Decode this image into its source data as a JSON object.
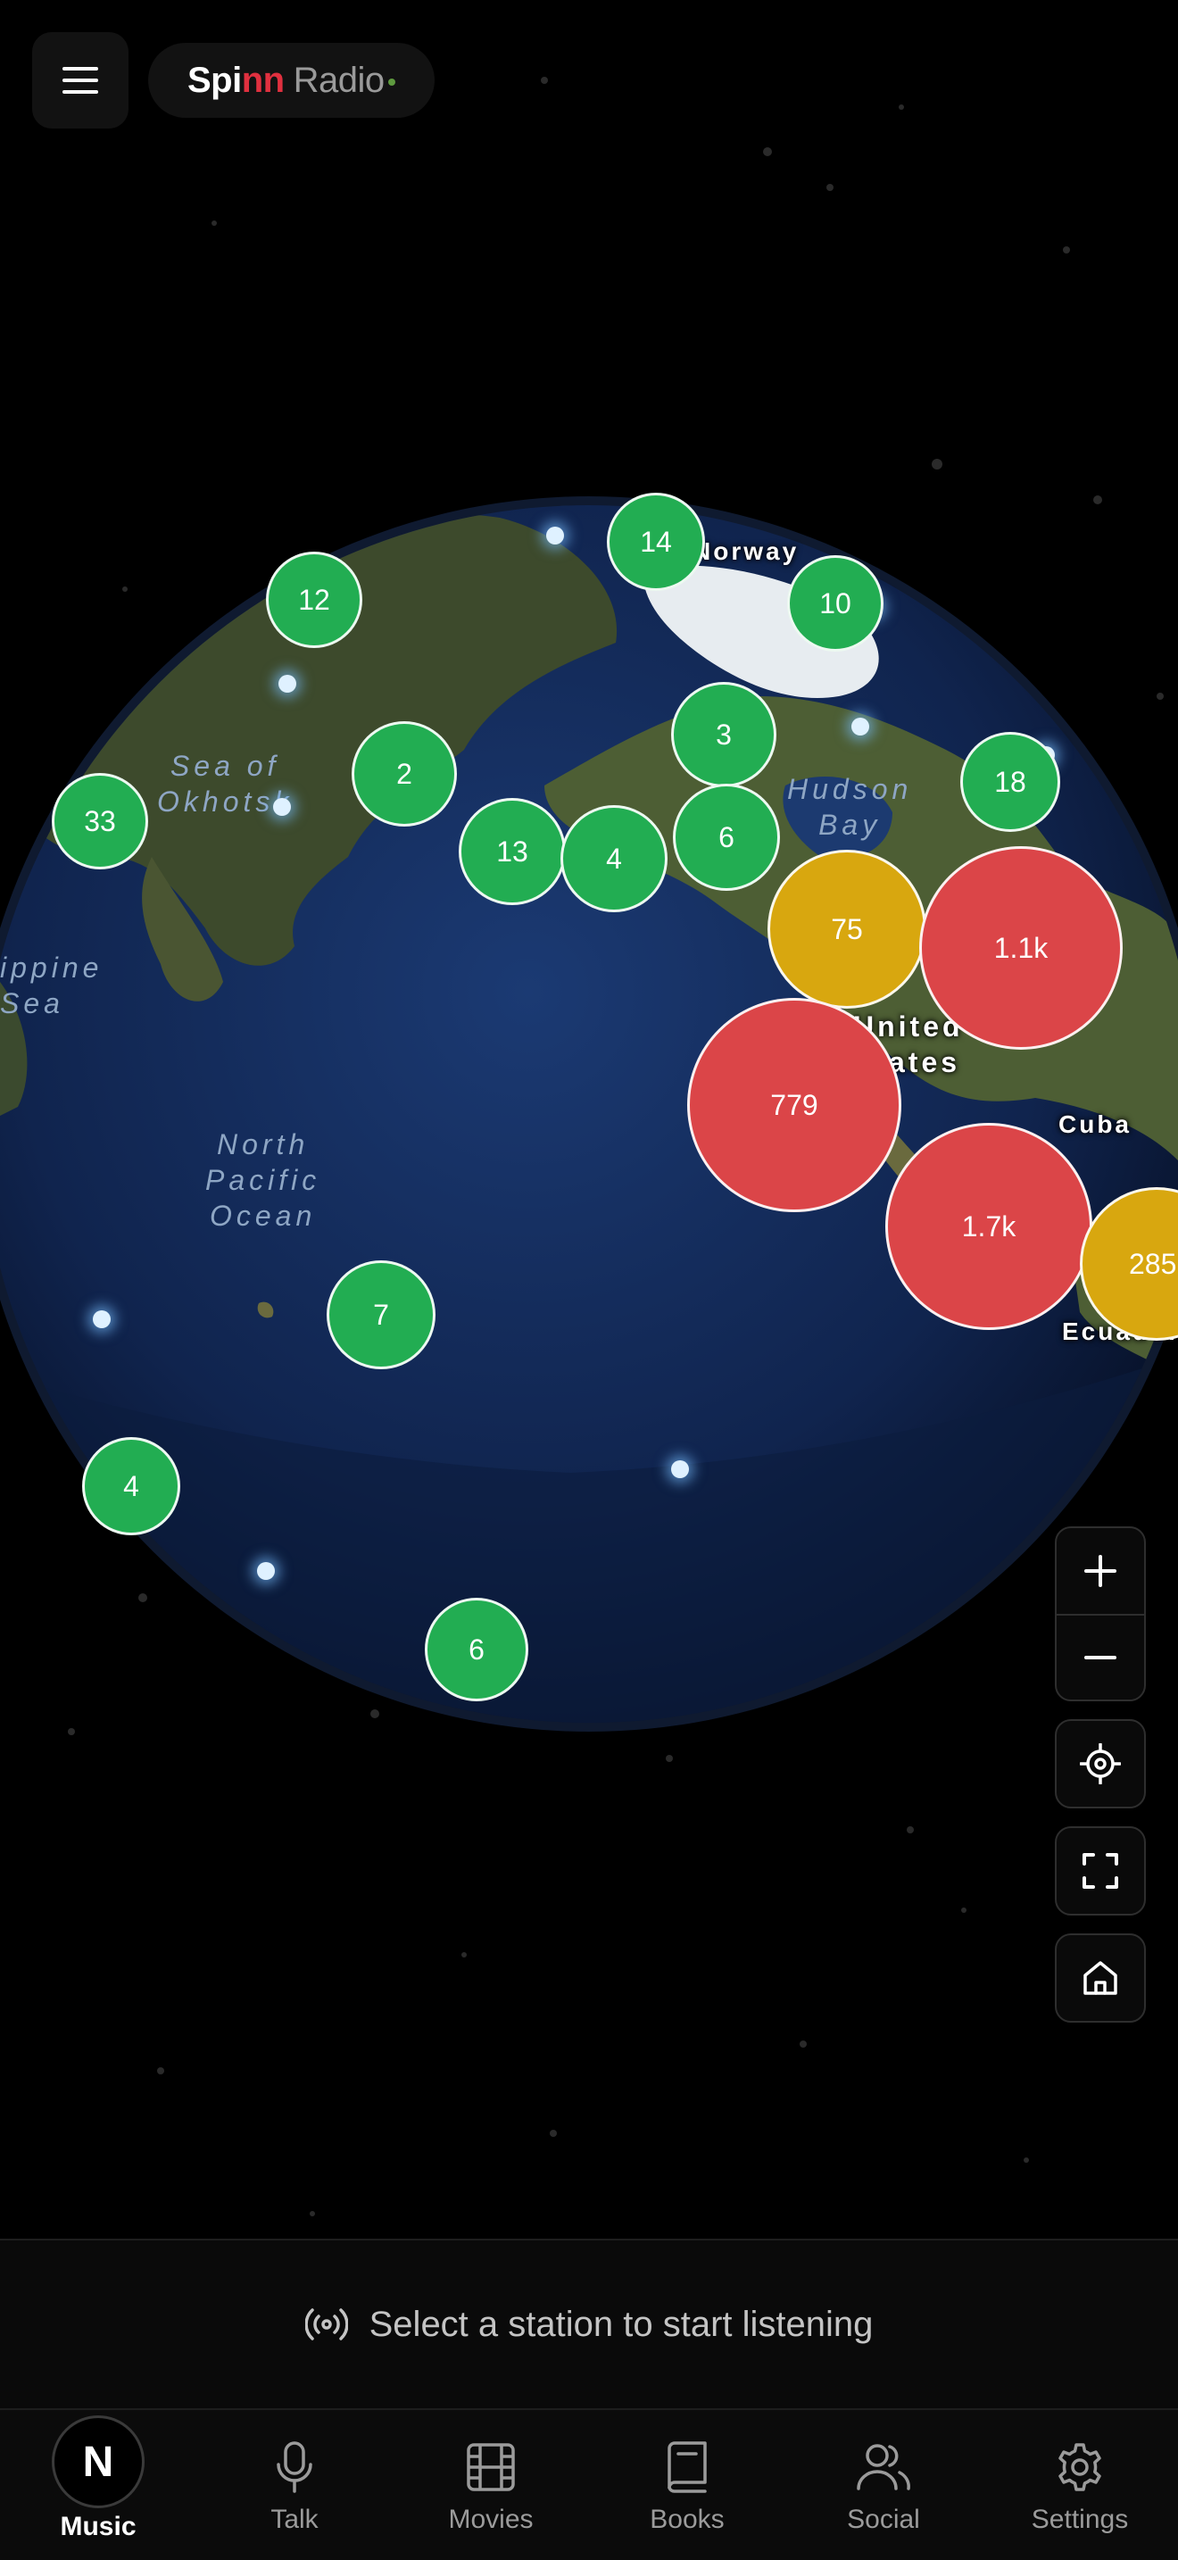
{
  "header": {
    "menu_icon": "hamburger-icon",
    "brand": {
      "part1": "Spi",
      "part2": "nn",
      "part3": "Radio"
    }
  },
  "globe": {
    "clusters": [
      {
        "count": "14",
        "level": "green"
      },
      {
        "count": "12",
        "level": "green"
      },
      {
        "count": "10",
        "level": "green"
      },
      {
        "count": "3",
        "level": "green"
      },
      {
        "count": "18",
        "level": "green"
      },
      {
        "count": "2",
        "level": "green"
      },
      {
        "count": "33",
        "level": "green"
      },
      {
        "count": "13",
        "level": "green"
      },
      {
        "count": "4",
        "level": "green"
      },
      {
        "count": "6",
        "level": "green"
      },
      {
        "count": "75",
        "level": "yellow"
      },
      {
        "count": "1.1k",
        "level": "red"
      },
      {
        "count": "779",
        "level": "red"
      },
      {
        "count": "1.7k",
        "level": "red"
      },
      {
        "count": "285",
        "level": "yellow"
      },
      {
        "count": "7",
        "level": "green"
      },
      {
        "count": "4",
        "level": "green"
      },
      {
        "count": "6",
        "level": "green"
      }
    ],
    "labels": {
      "norway": "Norway",
      "hudson_bay": "Hudson\nBay",
      "sea_of_okhotsk": "Sea of\nOkhotsk",
      "philippine_sea": "ippine\nSea",
      "north_pacific": "North\nPacific\nOcean",
      "united_states": "United\nStates",
      "cuba": "Cuba",
      "ecuador": "Ecuador"
    },
    "colors": {
      "green": "#22ad52",
      "yellow": "#d8a70f",
      "red": "#db4548"
    }
  },
  "map_controls": {
    "zoom_in_icon": "plus-icon",
    "zoom_out_icon": "minus-icon",
    "locate_icon": "crosshair-icon",
    "fullscreen_icon": "fullscreen-icon",
    "home_icon": "home-icon"
  },
  "now_playing": {
    "icon": "broadcast-icon",
    "text": "Select a station to start listening"
  },
  "nav": {
    "items": [
      {
        "label": "Music",
        "icon": "n-logo-icon",
        "active": true
      },
      {
        "label": "Talk",
        "icon": "microphone-icon"
      },
      {
        "label": "Movies",
        "icon": "film-icon"
      },
      {
        "label": "Books",
        "icon": "book-icon"
      },
      {
        "label": "Social",
        "icon": "users-icon"
      },
      {
        "label": "Settings",
        "icon": "gear-icon"
      }
    ],
    "logo_letter": "N"
  }
}
